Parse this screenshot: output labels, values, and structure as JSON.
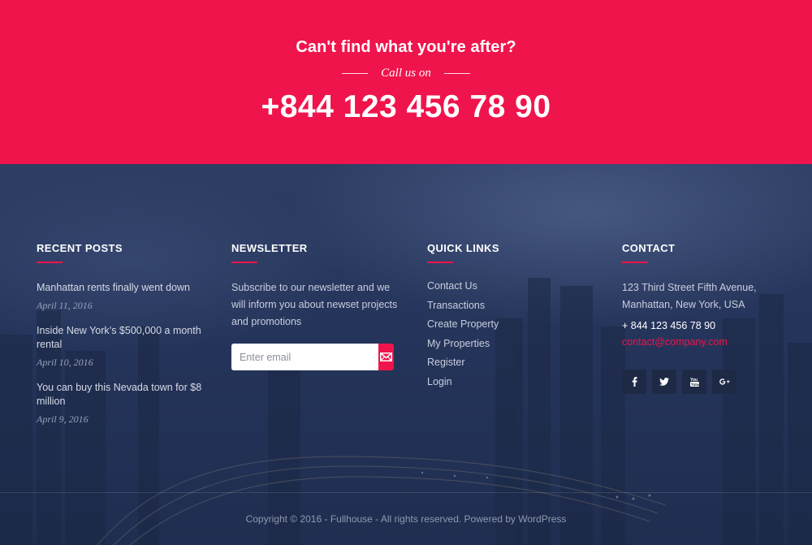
{
  "cta": {
    "title": "Can't find what you're after?",
    "subtitle": "Call us on",
    "phone": "+844 123 456 78 90"
  },
  "recent_posts": {
    "title": "RECENT POSTS",
    "items": [
      {
        "title": "Manhattan rents finally went down",
        "date": "April 11, 2016"
      },
      {
        "title": "Inside New York’s $500,000 a month rental",
        "date": "April 10, 2016"
      },
      {
        "title": "You can buy this Nevada town for $8 million",
        "date": "April 9, 2016"
      }
    ]
  },
  "newsletter": {
    "title": "NEWSLETTER",
    "text": "Subscribe to our newsletter and we will inform you about newset projects and promotions",
    "placeholder": "Enter email",
    "button_icon": "envelope-icon"
  },
  "quick_links": {
    "title": "QUICK LINKS",
    "items": [
      "Contact Us",
      "Transactions",
      "Create Property",
      "My Properties",
      "Register",
      "Login"
    ]
  },
  "contact": {
    "title": "CONTACT",
    "address": "123 Third Street Fifth Avenue, Manhattan, New York, USA",
    "phone": "+ 844 123 456 78 90",
    "email": "contact@company.com",
    "socials": [
      "facebook-icon",
      "twitter-icon",
      "youtube-icon",
      "google-plus-icon"
    ]
  },
  "copyright": "Copyright © 2016 - Fullhouse - All rights reserved. Powered by WordPress",
  "colors": {
    "accent": "#f0144c",
    "footer_bg": "#24335a",
    "social_bg": "#1e2a45"
  }
}
